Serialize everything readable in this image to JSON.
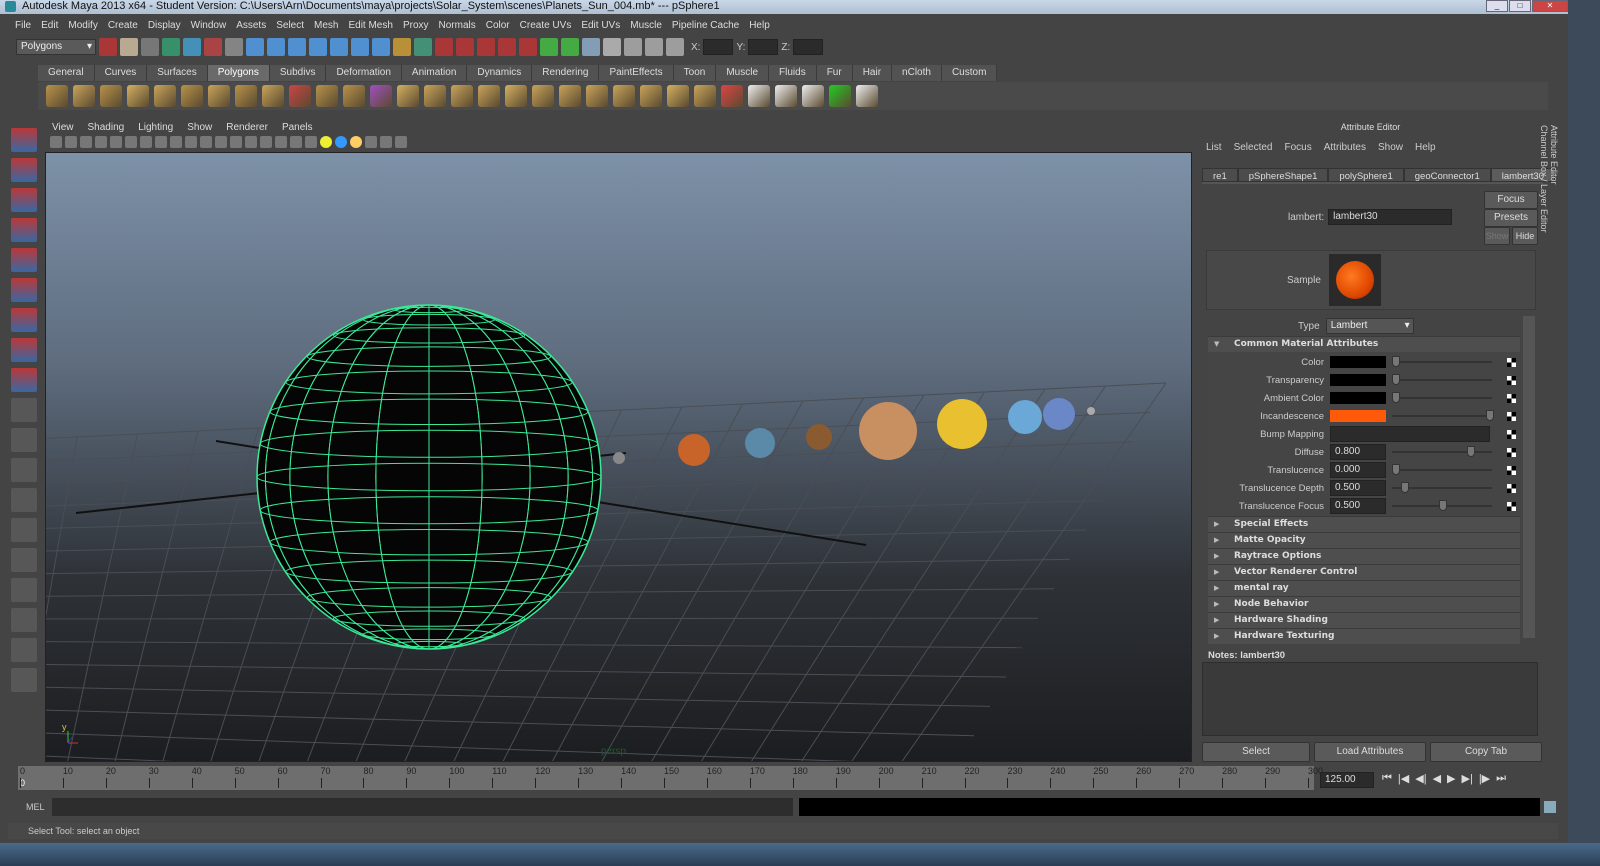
{
  "window": {
    "title": "Autodesk Maya 2013 x64 - Student Version: C:\\Users\\Arn\\Documents\\maya\\projects\\Solar_System\\scenes\\Planets_Sun_004.mb*  ---  pSphere1"
  },
  "menus": [
    "File",
    "Edit",
    "Modify",
    "Create",
    "Display",
    "Window",
    "Assets",
    "Select",
    "Mesh",
    "Edit Mesh",
    "Proxy",
    "Normals",
    "Color",
    "Create UVs",
    "Edit UVs",
    "Muscle",
    "Pipeline Cache",
    "Help"
  ],
  "toolbar": {
    "menuset": "Polygons",
    "x_label": "X:",
    "y_label": "Y:",
    "z_label": "Z:"
  },
  "shelf_tabs": [
    "General",
    "Curves",
    "Surfaces",
    "Polygons",
    "Subdivs",
    "Deformation",
    "Animation",
    "Dynamics",
    "Rendering",
    "PaintEffects",
    "Toon",
    "Muscle",
    "Fluids",
    "Fur",
    "Hair",
    "nCloth",
    "Custom"
  ],
  "shelf_active": "Polygons",
  "viewport": {
    "menus": [
      "View",
      "Shading",
      "Lighting",
      "Show",
      "Renderer",
      "Panels"
    ],
    "camera": "persp",
    "axis_y": "y"
  },
  "attribute_editor": {
    "title": "Attribute Editor",
    "menus": [
      "List",
      "Selected",
      "Focus",
      "Attributes",
      "Show",
      "Help"
    ],
    "tabs": [
      "re1",
      "pSphereShape1",
      "polySphere1",
      "geoConnector1",
      "lambert30"
    ],
    "active_tab": "lambert30",
    "node_label": "lambert:",
    "node_name": "lambert30",
    "focus": "Focus",
    "presets": "Presets",
    "show": "Show",
    "hide": "Hide",
    "sample_label": "Sample",
    "type_label": "Type",
    "type_value": "Lambert",
    "section_common": "Common Material Attributes",
    "attributes": [
      {
        "label": "Color",
        "swatch": "#000000",
        "slider": 0
      },
      {
        "label": "Transparency",
        "swatch": "#000000",
        "slider": 0
      },
      {
        "label": "Ambient Color",
        "swatch": "#000000",
        "slider": 0
      },
      {
        "label": "Incandescence",
        "swatch": "#ff5a0a",
        "slider": 1
      },
      {
        "label": "Bump Mapping"
      },
      {
        "label": "Diffuse",
        "value": "0.800",
        "slider": 0.8
      },
      {
        "label": "Translucence",
        "value": "0.000",
        "slider": 0
      },
      {
        "label": "Translucence Depth",
        "value": "0.500",
        "slider": 0.1
      },
      {
        "label": "Translucence Focus",
        "value": "0.500",
        "slider": 0.5
      }
    ],
    "sections": [
      "Special Effects",
      "Matte Opacity",
      "Raytrace Options",
      "Vector Renderer Control",
      "mental ray",
      "Node Behavior",
      "Hardware Shading",
      "Hardware Texturing"
    ],
    "notes": "Notes:  lambert30",
    "buttons": [
      "Select",
      "Load Attributes",
      "Copy Tab"
    ]
  },
  "side_tabs": [
    "Attribute Editor",
    "Channel Box / Layer Editor"
  ],
  "timeline": {
    "start": 0,
    "end": 300,
    "step": 10,
    "current_frame_label": "0",
    "current_time": "125.00"
  },
  "command_line": {
    "label": "MEL"
  },
  "status": "Select Tool: select an object"
}
